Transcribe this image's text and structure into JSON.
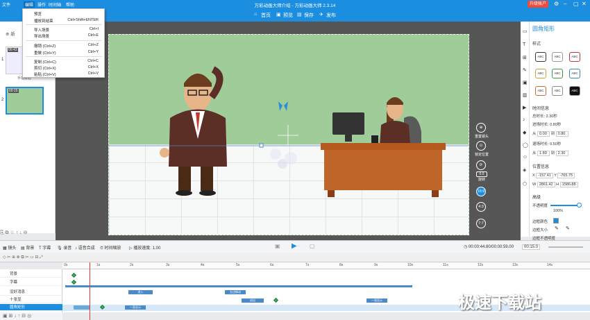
{
  "app_title": "万彩动画大师介绍 - 万彩动画大师 2.3.14",
  "menubar": [
    "文件",
    "编辑",
    "操作",
    "时间轴",
    "帮助"
  ],
  "upgrade_label": "升级账户",
  "toolbar": {
    "home": "首页",
    "preview": "预览",
    "save": "保存",
    "publish": "发布"
  },
  "edit_menu": [
    {
      "label": "预览",
      "shortcut": ""
    },
    {
      "label": "播放到结束",
      "shortcut": "Ctrl+Shift+ENTER"
    },
    {
      "label": "导入场景",
      "shortcut": "Ctrl+I"
    },
    {
      "label": "导出场景",
      "shortcut": "Ctrl+E"
    },
    {
      "label": "撤销 (Ctrl+Z)",
      "shortcut": "Ctrl+Z"
    },
    {
      "label": "重做 (Ctrl+Y)",
      "shortcut": "Ctrl+Y"
    },
    {
      "label": "复制 (Ctrl+C)",
      "shortcut": "Ctrl+C"
    },
    {
      "label": "剪切 (Ctrl+X)",
      "shortcut": "Ctrl+X"
    },
    {
      "label": "粘贴 (Ctrl+V)",
      "shortcut": "Ctrl+V"
    }
  ],
  "left_panel": {
    "new_scene": "新",
    "scene1_time": "00:43",
    "scene1_label": "手指按钮",
    "scene2_time": "00:15",
    "scene_numbers": [
      "1",
      "2"
    ]
  },
  "side_controls": {
    "camera": "重置镜头",
    "follow": "锁定位置",
    "rotate": "旋转",
    "rotate_value": "0.0",
    "ratio1": "16:9",
    "ratio2": "4:3",
    "ratio3": "7:7"
  },
  "panel": {
    "title": "圆角矩形",
    "style_label": "样式",
    "abc": "ABC",
    "time_info": "时间信息",
    "total_label": "总时长:",
    "total": "2.30秒",
    "enter_label": "进场时长:",
    "enter": "0.80秒",
    "from1_label": "从",
    "from1": "0.00",
    "to1_label": "到",
    "to1": "0.80",
    "exit_label": "退场时长:",
    "exit": "0.50秒",
    "from2": "1.80",
    "to2": "2.30",
    "pos_info": "位置信息",
    "x_label": "X",
    "x": "-157.41",
    "y_label": "Y",
    "y": "-765.75",
    "w_label": "W",
    "w": "2861.42",
    "h_label": "H",
    "h": "1586.88",
    "advanced": "高级",
    "opacity_label": "不透明度",
    "opacity": "100%",
    "border_color": "边框颜色",
    "border_size": "边框大小",
    "border_opacity": "边框不透明度"
  },
  "playbar": {
    "lens": "镜头",
    "bg": "背景",
    "subtitle": "字幕",
    "voice": "录音",
    "synth": "语音合成",
    "time_scale": "时间缩放",
    "speed": "播放速度: 1.00",
    "time": "00:00:44.80/00:00:59.00",
    "zoom": "00:15.0"
  },
  "ruler": [
    "0s",
    "1s",
    "2s",
    "3s",
    "4s",
    "5s",
    "6s",
    "7s",
    "8s",
    "9s",
    "10s",
    "11s",
    "12s",
    "13s",
    "14s"
  ],
  "layers": [
    "背景",
    "字幕",
    "没好消息",
    "十张显",
    "圆角矩形"
  ],
  "track_bars": [
    "进入",
    "左边移动",
    "退出",
    "一直显示",
    "一直显示"
  ],
  "watermark": "极速下载站"
}
